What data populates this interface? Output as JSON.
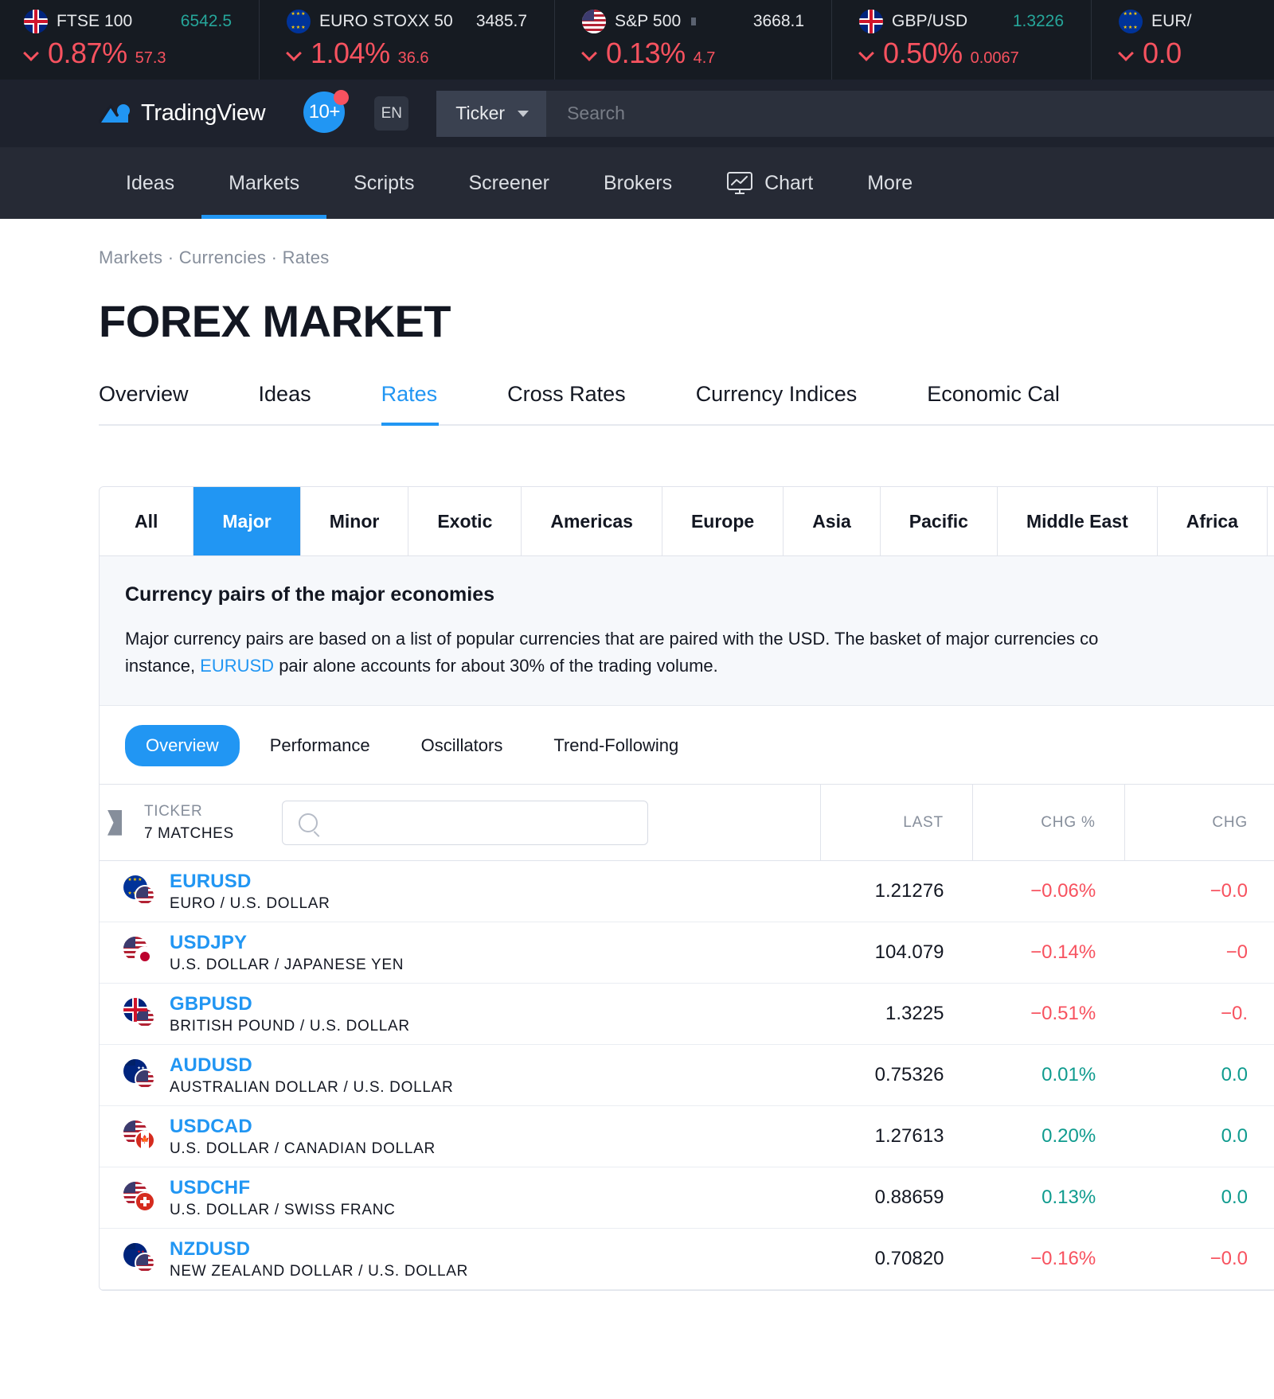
{
  "ticker_bar": {
    "items": [
      {
        "flag": "uk-flag-icon",
        "name": "FTSE 100",
        "last": "6542.5",
        "last_dir": "up",
        "pct": "0.87%",
        "abs": "57.3",
        "dir": "down",
        "has_dot": false
      },
      {
        "flag": "eu-flag-icon",
        "name": "EURO STOXX 50",
        "last": "3485.7",
        "last_dir": "neutral",
        "pct": "1.04%",
        "abs": "36.6",
        "dir": "down",
        "has_dot": false
      },
      {
        "flag": "us-flag-icon",
        "name": "S&P 500",
        "last": "3668.1",
        "last_dir": "neutral",
        "pct": "0.13%",
        "abs": "4.7",
        "dir": "down",
        "has_dot": true
      },
      {
        "flag": "uk-flag-icon",
        "name": "GBP/USD",
        "last": "1.3226",
        "last_dir": "up",
        "pct": "0.50%",
        "abs": "0.0067",
        "dir": "down",
        "has_dot": false
      },
      {
        "flag": "eu-flag-icon",
        "name": "EUR/",
        "last": "",
        "last_dir": "neutral",
        "pct": "0.0",
        "abs": "",
        "dir": "down",
        "has_dot": false
      }
    ]
  },
  "header": {
    "logo_text": "TradingView",
    "notifications_badge": "10+",
    "language": "EN",
    "search_scope": "Ticker",
    "search_placeholder": "Search"
  },
  "nav": {
    "items": [
      {
        "label": "Ideas",
        "active": false,
        "icon": null
      },
      {
        "label": "Markets",
        "active": true,
        "icon": null
      },
      {
        "label": "Scripts",
        "active": false,
        "icon": null
      },
      {
        "label": "Screener",
        "active": false,
        "icon": null
      },
      {
        "label": "Brokers",
        "active": false,
        "icon": null
      },
      {
        "label": "Chart",
        "active": false,
        "icon": "chart-monitor-icon"
      },
      {
        "label": "More",
        "active": false,
        "icon": null
      }
    ]
  },
  "page": {
    "breadcrumb": "Markets · Currencies · Rates",
    "title": "FOREX MARKET",
    "tabs": [
      {
        "label": "Overview",
        "active": false
      },
      {
        "label": "Ideas",
        "active": false
      },
      {
        "label": "Rates",
        "active": true
      },
      {
        "label": "Cross Rates",
        "active": false
      },
      {
        "label": "Currency Indices",
        "active": false
      },
      {
        "label": "Economic Cal",
        "active": false
      }
    ]
  },
  "widget": {
    "filters": [
      {
        "label": "All",
        "active": false
      },
      {
        "label": "Major",
        "active": true
      },
      {
        "label": "Minor",
        "active": false
      },
      {
        "label": "Exotic",
        "active": false
      },
      {
        "label": "Americas",
        "active": false
      },
      {
        "label": "Europe",
        "active": false
      },
      {
        "label": "Asia",
        "active": false
      },
      {
        "label": "Pacific",
        "active": false
      },
      {
        "label": "Middle East",
        "active": false
      },
      {
        "label": "Africa",
        "active": false
      }
    ],
    "description": {
      "title": "Currency pairs of the major economies",
      "text_part1": "Major currency pairs are based on a list of popular currencies that are paired with the USD. The basket of major currencies co",
      "text_part2": "instance, ",
      "link": "EURUSD",
      "text_part3": " pair alone accounts for about 30% of the trading volume."
    },
    "subtabs": [
      {
        "label": "Overview",
        "active": true
      },
      {
        "label": "Performance",
        "active": false
      },
      {
        "label": "Oscillators",
        "active": false
      },
      {
        "label": "Trend-Following",
        "active": false
      }
    ],
    "table": {
      "header": {
        "ticker_label": "TICKER",
        "matches": "7 MATCHES",
        "search_placeholder": "",
        "col_last": "LAST",
        "col_chg_pct": "CHG %",
        "col_chg": "CHG"
      },
      "rows": [
        {
          "symbol": "EURUSD",
          "desc": "EURO / U.S. DOLLAR",
          "flag_a": "eu-flag-icon",
          "flag_b": "us-flag-icon",
          "last": "1.21276",
          "chg_pct": "−0.06%",
          "chg": "−0.0",
          "dir": "down"
        },
        {
          "symbol": "USDJPY",
          "desc": "U.S. DOLLAR / JAPANESE YEN",
          "flag_a": "us-flag-icon",
          "flag_b": "jp-flag-icon",
          "last": "104.079",
          "chg_pct": "−0.14%",
          "chg": "−0",
          "dir": "down"
        },
        {
          "symbol": "GBPUSD",
          "desc": "BRITISH POUND / U.S. DOLLAR",
          "flag_a": "uk-flag-icon",
          "flag_b": "us-flag-icon",
          "last": "1.3225",
          "chg_pct": "−0.51%",
          "chg": "−0.",
          "dir": "down"
        },
        {
          "symbol": "AUDUSD",
          "desc": "AUSTRALIAN DOLLAR / U.S. DOLLAR",
          "flag_a": "au-flag-icon",
          "flag_b": "us-flag-icon",
          "last": "0.75326",
          "chg_pct": "0.01%",
          "chg": "0.0",
          "dir": "up"
        },
        {
          "symbol": "USDCAD",
          "desc": "U.S. DOLLAR / CANADIAN DOLLAR",
          "flag_a": "us-flag-icon",
          "flag_b": "ca-flag-icon",
          "last": "1.27613",
          "chg_pct": "0.20%",
          "chg": "0.0",
          "dir": "up"
        },
        {
          "symbol": "USDCHF",
          "desc": "U.S. DOLLAR / SWISS FRANC",
          "flag_a": "us-flag-icon",
          "flag_b": "ch-flag-icon",
          "last": "0.88659",
          "chg_pct": "0.13%",
          "chg": "0.0",
          "dir": "up"
        },
        {
          "symbol": "NZDUSD",
          "desc": "NEW ZEALAND DOLLAR / U.S. DOLLAR",
          "flag_a": "nz-flag-icon",
          "flag_b": "us-flag-icon",
          "last": "0.70820",
          "chg_pct": "−0.16%",
          "chg": "−0.0",
          "dir": "down"
        }
      ]
    }
  },
  "colors": {
    "accent": "#2196f3",
    "down": "#f7525f",
    "up": "#0f9b8e",
    "dark_bg": "#1e222d",
    "ticker_bg": "#161b22"
  }
}
